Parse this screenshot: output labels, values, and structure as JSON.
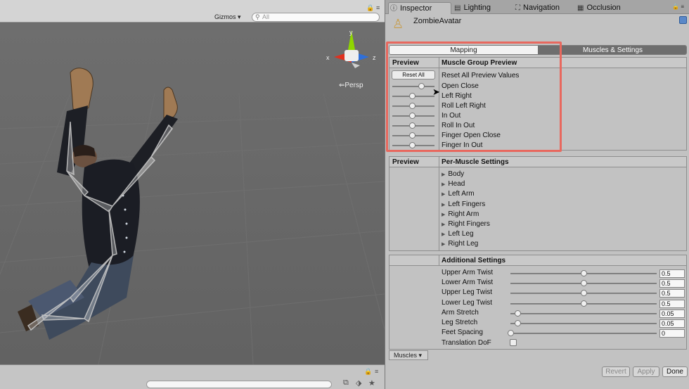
{
  "scene": {
    "gizmos_label": "Gizmos ▾",
    "search_placeholder": "All",
    "persp_label": "Persp",
    "axis_labels": {
      "x": "x",
      "y": "y",
      "z": "z"
    }
  },
  "inspector": {
    "tabs": [
      {
        "label": "Inspector",
        "icon": "info-icon",
        "active": true
      },
      {
        "label": "Lighting",
        "icon": "lighting-icon",
        "active": false
      },
      {
        "label": "Navigation",
        "icon": "navigation-icon",
        "active": false
      },
      {
        "label": "Occlusion",
        "icon": "occlusion-icon",
        "active": false
      }
    ],
    "object_name": "ZombieAvatar",
    "segments": {
      "mapping": "Mapping",
      "muscles": "Muscles & Settings",
      "selected": "Muscles & Settings"
    },
    "muscle_group": {
      "col_preview": "Preview",
      "col_title": "Muscle Group Preview",
      "reset_button": "Reset All",
      "reset_label": "Reset All Preview Values",
      "sliders": [
        {
          "label": "Open Close",
          "value": 0.75
        },
        {
          "label": "Left Right",
          "value": 0.5
        },
        {
          "label": "Roll Left Right",
          "value": 0.5
        },
        {
          "label": "In Out",
          "value": 0.5
        },
        {
          "label": "Roll In Out",
          "value": 0.5
        },
        {
          "label": "Finger Open Close",
          "value": 0.5
        },
        {
          "label": "Finger In Out",
          "value": 0.5
        }
      ]
    },
    "per_muscle": {
      "col_preview": "Preview",
      "col_title": "Per-Muscle Settings",
      "items": [
        "Body",
        "Head",
        "Left Arm",
        "Left Fingers",
        "Right Arm",
        "Right Fingers",
        "Left Leg",
        "Right Leg"
      ]
    },
    "additional": {
      "title": "Additional Settings",
      "rows": [
        {
          "label": "Upper Arm Twist",
          "value": "0.5",
          "fraction": 0.5
        },
        {
          "label": "Lower Arm Twist",
          "value": "0.5",
          "fraction": 0.5
        },
        {
          "label": "Upper Leg Twist",
          "value": "0.5",
          "fraction": 0.5
        },
        {
          "label": "Lower Leg Twist",
          "value": "0.5",
          "fraction": 0.5
        },
        {
          "label": "Arm Stretch",
          "value": "0.05",
          "fraction": 0.05
        },
        {
          "label": "Leg Stretch",
          "value": "0.05",
          "fraction": 0.05
        },
        {
          "label": "Feet Spacing",
          "value": "0",
          "fraction": 0.0
        }
      ],
      "translation_dof_label": "Translation DoF",
      "translation_dof_checked": false
    },
    "muscles_dropdown": "Muscles ▾",
    "buttons": {
      "revert": "Revert",
      "apply": "Apply",
      "done": "Done"
    }
  },
  "colors": {
    "highlight": "#e8685e",
    "scene_bg": "#696969",
    "panel_bg": "#c2c2c2"
  }
}
